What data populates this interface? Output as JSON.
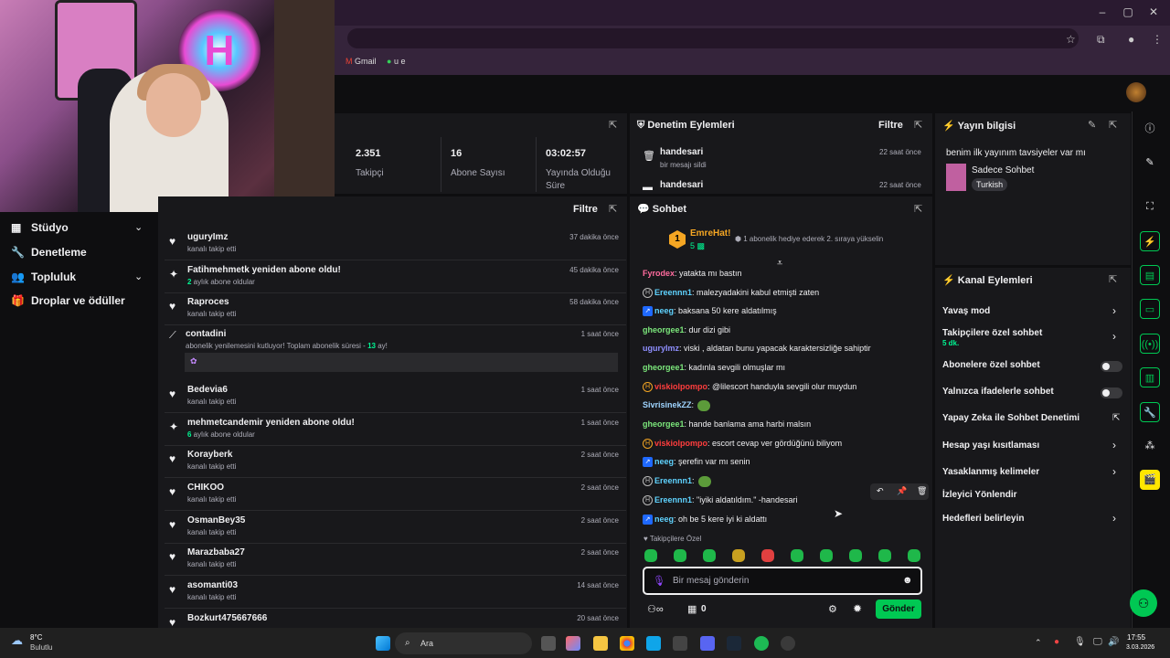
{
  "browser": {
    "bookmarks": [
      "Gmail",
      "u e"
    ]
  },
  "leftnav": {
    "items": [
      {
        "label": "Stüdyo",
        "icon": "studio-icon"
      },
      {
        "label": "Denetleme",
        "icon": "wrench-icon"
      },
      {
        "label": "Topluluk",
        "icon": "people-icon"
      },
      {
        "label": "Droplar ve ödüller",
        "icon": "gift-icon"
      }
    ]
  },
  "stats": [
    {
      "value": "2.351",
      "label": "Takipçi"
    },
    {
      "value": "16",
      "label": "Abone Sayısı"
    },
    {
      "value": "03:02:57",
      "label": "Yayında Olduğu Süre"
    }
  ],
  "activity": {
    "filter_label": "Filtre",
    "rows": [
      {
        "icon": "heart-icon",
        "name": "uguryImz",
        "sub": "kanalı takip etti",
        "time": "37 dakika önce"
      },
      {
        "icon": "sparkle-icon",
        "name": "Fatihmehmetk yeniden abone oldu!",
        "sub_num": "2",
        "sub": " aylık abone oldular",
        "time": "45 dakika önce"
      },
      {
        "icon": "heart-icon",
        "name": "Raproces",
        "sub": "kanalı takip etti",
        "time": "58 dakika önce"
      },
      {
        "icon": "heart-icon",
        "name": "Bedevia6",
        "sub": "kanalı takip etti",
        "time": "1 saat önce"
      },
      {
        "icon": "sparkle-icon",
        "name": "mehmetcandemir yeniden abone oldu!",
        "sub_num": "6",
        "sub": " aylık abone oldular",
        "time": "1 saat önce"
      },
      {
        "icon": "heart-icon",
        "name": "Korayberk",
        "sub": "kanalı takip etti",
        "time": "2 saat önce"
      },
      {
        "icon": "heart-icon",
        "name": "CHIKOO",
        "sub": "kanalı takip etti",
        "time": "2 saat önce"
      },
      {
        "icon": "heart-icon",
        "name": "OsmanBey35",
        "sub": "kanalı takip etti",
        "time": "2 saat önce"
      },
      {
        "icon": "heart-icon",
        "name": "Marazbaba27",
        "sub": "kanalı takip etti",
        "time": "2 saat önce"
      },
      {
        "icon": "heart-icon",
        "name": "asomanti03",
        "sub": "kanalı takip etti",
        "time": "14 saat önce"
      },
      {
        "icon": "heart-icon",
        "name": "Bozkurt475667666",
        "sub": "",
        "time": "20 saat önce"
      }
    ],
    "resub": {
      "name": "contadini",
      "text_pre": "abonelik yenilemesini kutluyor! Toplam abonelik süresi - ",
      "months": "13",
      "text_post": " ay!",
      "time": "1 saat önce"
    }
  },
  "moderation": {
    "title": "Denetim Eylemleri",
    "filter_label": "Filtre",
    "items": [
      {
        "name": "handesari",
        "sub": "bir mesajı sildi",
        "time": "22 saat önce"
      },
      {
        "name": "handesari",
        "sub": "",
        "time": "22 saat önce"
      }
    ]
  },
  "chat": {
    "title": "Sohbet",
    "hype": {
      "rank": "1",
      "user": "EmreHat!",
      "count": "5",
      "text": "1 abonelik hediye ederek 2. sıraya yükselin"
    },
    "messages": [
      {
        "user": "Fyrodex",
        "color": "#ff6b9e",
        "badge": "",
        "text": ": yatakta mı bastın"
      },
      {
        "user": "Ereennn1",
        "color": "#5fd3ff",
        "badge": "H",
        "text": ": malezyadakini kabul etmişti zaten"
      },
      {
        "user": "neeg",
        "color": "#5fd3ff",
        "badge": "sq",
        "text": ": baksana 50 kere aldatılmış"
      },
      {
        "user": "gheorgee1",
        "color": "#7be67b",
        "badge": "",
        "text": ": dur dizi gibi"
      },
      {
        "user": "uguryImz",
        "color": "#8f8fff",
        "badge": "",
        "text": ": viski , aldatan bunu yapacak karaktersizliğe sahiptir"
      },
      {
        "user": "gheorgee1",
        "color": "#7be67b",
        "badge": "",
        "text": ": kadınla sevgili olmuşlar mı"
      },
      {
        "user": "viskiolpompo",
        "color": "#ff3d3d",
        "badge": "gold",
        "text": ": @lilescort handuyla sevgili olur muydun"
      },
      {
        "user": "SivrisinekZZ",
        "color": "#9fd4ff",
        "badge": "",
        "text": ":",
        "emote": true
      },
      {
        "user": "gheorgee1",
        "color": "#7be67b",
        "badge": "",
        "text": ": hande banlama ama harbi malsın"
      },
      {
        "user": "viskiolpompo",
        "color": "#ff3d3d",
        "badge": "gold",
        "text": ": escort cevap ver gördüğünü biliyom"
      },
      {
        "user": "neeg",
        "color": "#5fd3ff",
        "badge": "sq",
        "text": ": şerefin var mı senin"
      },
      {
        "user": "Ereennn1",
        "color": "#5fd3ff",
        "badge": "H",
        "text": ":",
        "emote": true
      },
      {
        "user": "Ereennn1",
        "color": "#5fd3ff",
        "badge": "H",
        "text": ": \"iyiki aldatıldım.\" -handesari"
      },
      {
        "user": "neeg",
        "color": "#5fd3ff",
        "badge": "sq",
        "text": ": oh be 5 kere iyi ki aldattı"
      }
    ],
    "follower_only_label": "Takipçilere Özel",
    "placeholder": "Bir mesaj gönderin",
    "points": "0",
    "send_label": "Gönder"
  },
  "stream_info": {
    "title": "Yayın bilgisi",
    "stream_title": "benim ilk yayınım tavsiyeler var mı",
    "category": "Sadece Sohbet",
    "tag": "Turkish"
  },
  "channel_actions": {
    "title": "Kanal Eylemleri",
    "items": [
      {
        "label": "Yavaş mod",
        "control": "chevron"
      },
      {
        "label": "Takipçilere özel sohbet",
        "sub": "5 dk.",
        "control": "chevron"
      },
      {
        "label": "Abonelere özel sohbet",
        "control": "toggle"
      },
      {
        "label": "Yalnızca ifadelerle sohbet",
        "control": "toggle"
      },
      {
        "label": "Yapay Zeka ile Sohbet Denetimi",
        "control": "external"
      },
      {
        "label": "Hesap yaşı kısıtlaması",
        "control": "chevron"
      },
      {
        "label": "Yasaklanmış kelimeler",
        "control": "chevron"
      },
      {
        "label": "İzleyici Yönlendir",
        "control": "none"
      },
      {
        "label": "Hedefleri belirleyin",
        "control": "chevron"
      }
    ]
  },
  "taskbar": {
    "weather_temp": "8°C",
    "weather_desc": "Bulutlu",
    "search_label": "Ara",
    "time": "17:55",
    "date": "3.03.2026"
  },
  "colors": {
    "accent": "#00c853",
    "bg": "#0e0e10",
    "panel": "#18181b",
    "browser": "#35243b"
  }
}
